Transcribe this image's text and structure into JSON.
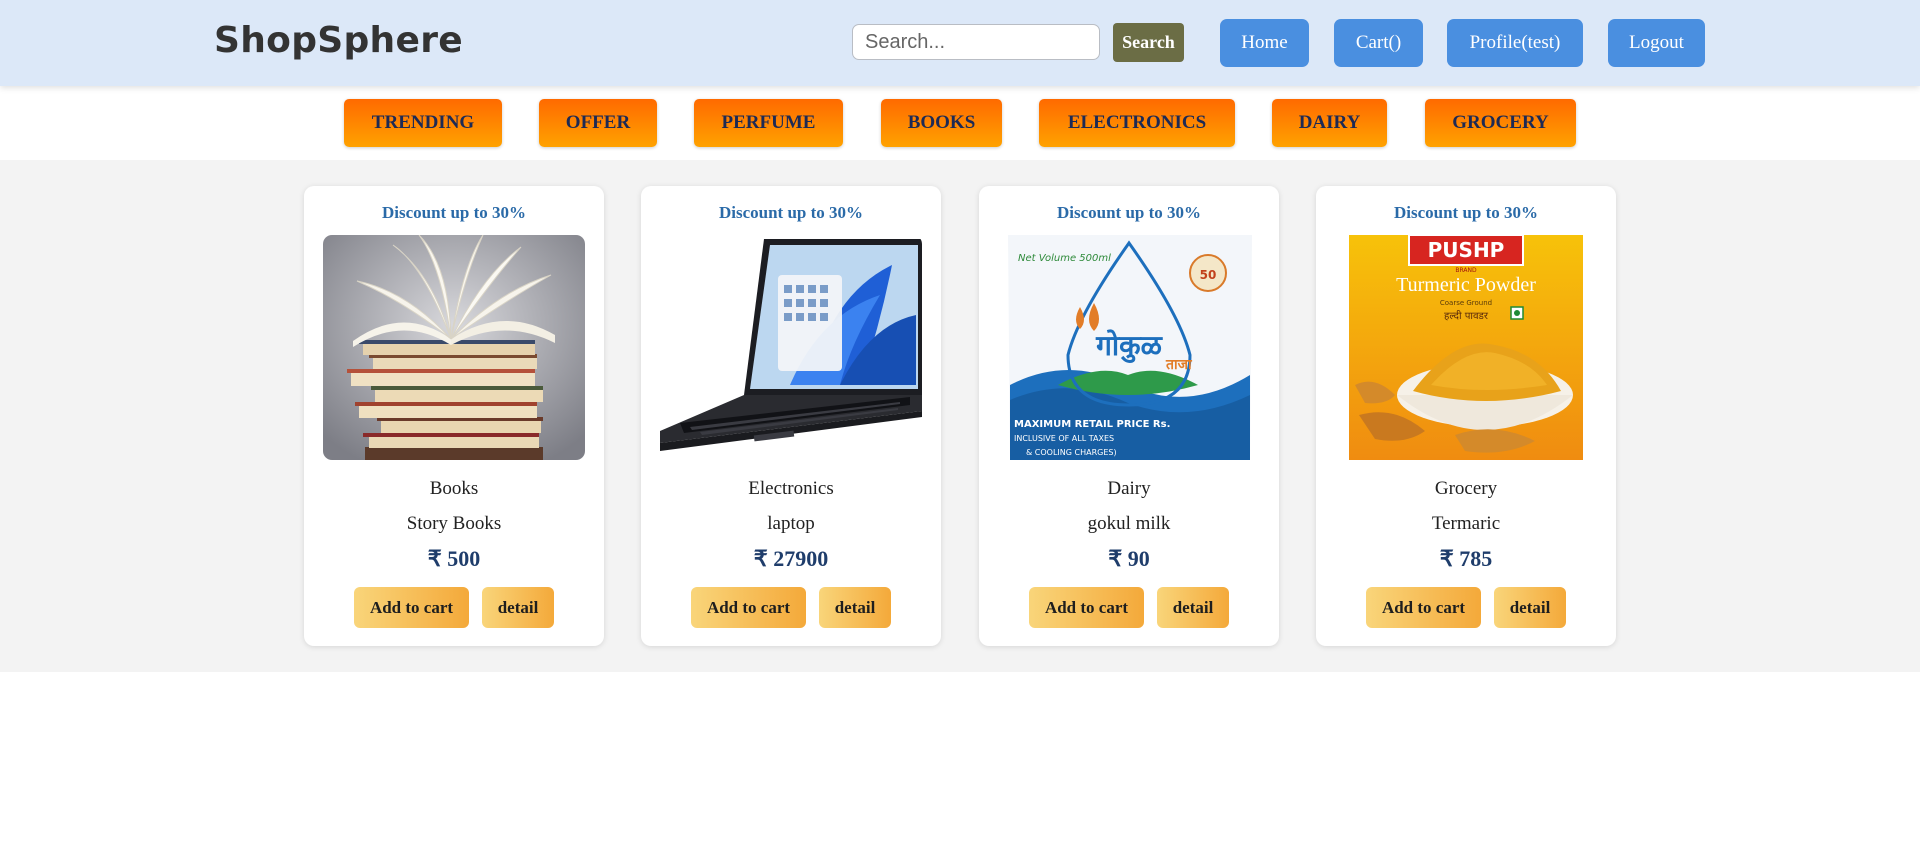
{
  "header": {
    "brand": "ShopSphere",
    "search": {
      "placeholder": "Search...",
      "value": ""
    },
    "search_button": "Search",
    "nav": [
      "Home",
      "Cart()",
      "Profile(test)",
      "Logout"
    ]
  },
  "categories": [
    "TRENDING",
    "OFFER",
    "PERFUME",
    "BOOKS",
    "ELECTRONICS",
    "DAIRY",
    "GROCERY"
  ],
  "products": [
    {
      "discount": "Discount up to 30%",
      "category": "Books",
      "name": "Story Books",
      "price": "₹ 500",
      "add_label": "Add to cart",
      "detail_label": "detail",
      "image": "books-stack-image"
    },
    {
      "discount": "Discount up to 30%",
      "category": "Electronics",
      "name": "laptop",
      "price": "₹ 27900",
      "add_label": "Add to cart",
      "detail_label": "detail",
      "image": "laptop-image"
    },
    {
      "discount": "Discount up to 30%",
      "category": "Dairy",
      "name": "gokul milk",
      "price": "₹ 90",
      "add_label": "Add to cart",
      "detail_label": "detail",
      "image": "milk-packet-image"
    },
    {
      "discount": "Discount up to 30%",
      "category": "Grocery",
      "name": "Termaric",
      "price": "₹ 785",
      "add_label": "Add to cart",
      "detail_label": "detail",
      "image": "turmeric-powder-image"
    }
  ],
  "image_text": {
    "milk_volume": "Net Volume 500ml",
    "milk_brand": "गोकुळ",
    "milk_sub": "ताजा",
    "milk_mrp": "MAXIMUM RETAIL PRICE Rs.",
    "milk_tax": "INCLUSIVE OF ALL TAXES",
    "milk_cooling": "& COOLING CHARGES)",
    "turmeric_brand": "PUSHP",
    "turmeric_brand_small": "BRAND",
    "turmeric_title": "Turmeric Powder",
    "turmeric_sub": "Coarse Ground",
    "turmeric_hindi": "हल्दी पावडर"
  },
  "colors": {
    "header_bg": "#dce8f8",
    "nav_button": "#4a8fe0",
    "search_button": "#6b6d45",
    "category_gradient": [
      "#ff6a00",
      "#ffa200"
    ],
    "discount_text": "#2a6aa8",
    "price_text": "#1f3d6b",
    "card_button_gradient": [
      "#f9d57a",
      "#f4a93a"
    ]
  }
}
